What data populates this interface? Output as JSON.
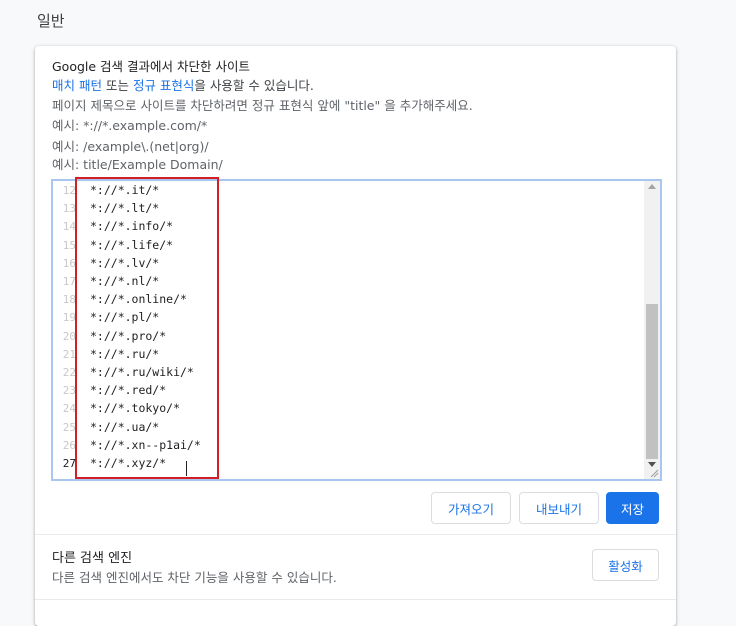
{
  "section": {
    "title": "일반"
  },
  "blocklist": {
    "title": "Google 검색 결과에서 차단한 사이트",
    "line2": {
      "link1": "매치 패턴",
      "text1": " 또는 ",
      "link2": "정규 표현식",
      "text2": "을 사용할 수 있습니다."
    },
    "line3": "페이지 제목으로 사이트를 차단하려면 정규 표현식 앞에 \"title\" 을 추가해주세요.",
    "example1": "예시: *://*.example.com/*",
    "example2": "예시: /example\\.(net|org)/",
    "example3": "예시: title/Example Domain/"
  },
  "editor": {
    "line_numbers": [
      "12",
      "13",
      "14",
      "15",
      "16",
      "17",
      "18",
      "19",
      "20",
      "21",
      "22",
      "23",
      "24",
      "25",
      "26",
      "27"
    ],
    "lines": [
      "*://*.it/*",
      "*://*.lt/*",
      "*://*.info/*",
      "*://*.life/*",
      "*://*.lv/*",
      "*://*.nl/*",
      "*://*.online/*",
      "*://*.pl/*",
      "*://*.pro/*",
      "*://*.ru/*",
      "*://*.ru/wiki/*",
      "*://*.red/*",
      "*://*.tokyo/*",
      "*://*.ua/*",
      "*://*.xn--p1ai/*",
      "*://*.xyz/*"
    ]
  },
  "buttons": {
    "import": "가져오기",
    "export": "내보내기",
    "save": "저장"
  },
  "other_engines": {
    "title": "다른 검색 엔진",
    "subtitle": "다른 검색 엔진에서도 차단 기능을 사용할 수 있습니다.",
    "activate": "활성화"
  },
  "colors": {
    "accent": "#1a73e8",
    "highlight": "#d21f26"
  }
}
